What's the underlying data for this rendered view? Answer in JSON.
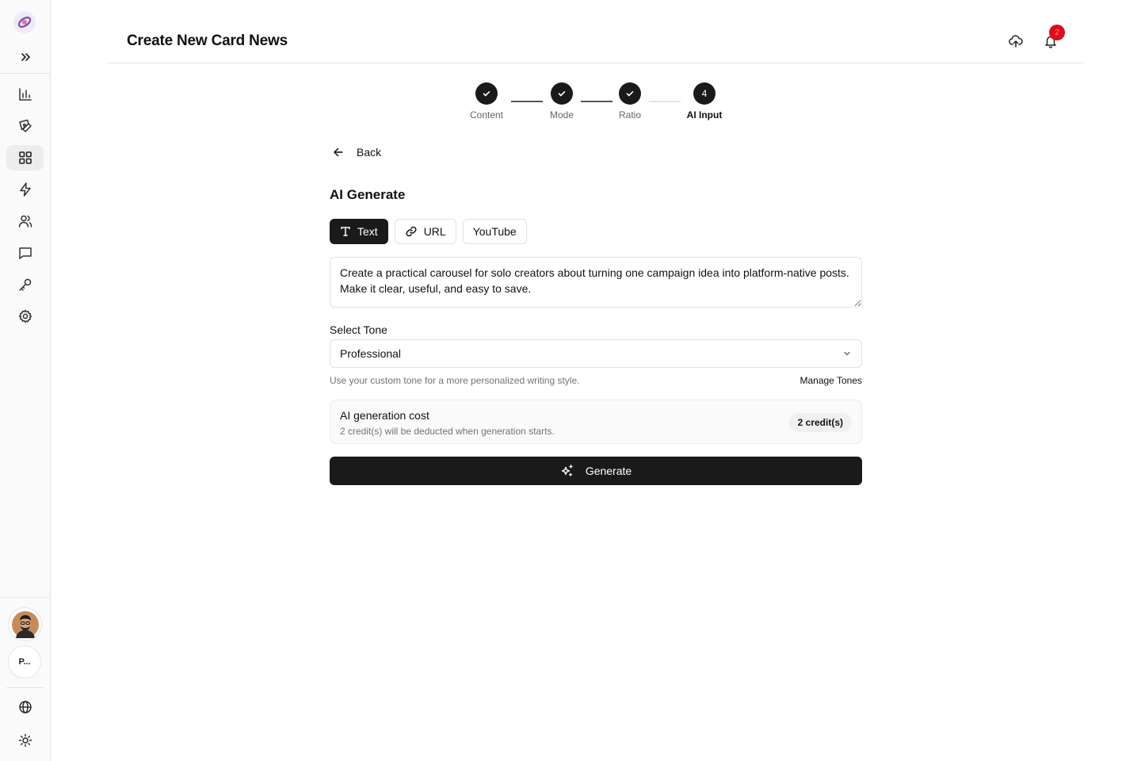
{
  "sidebar": {
    "nav_items": [
      {
        "icon": "bar-chart-icon",
        "active": false
      },
      {
        "icon": "pen-tool-icon",
        "active": false
      },
      {
        "icon": "grid-icon",
        "active": true
      },
      {
        "icon": "lightning-icon",
        "active": false
      },
      {
        "icon": "users-icon",
        "active": false
      },
      {
        "icon": "message-icon",
        "active": false
      },
      {
        "icon": "key-icon",
        "active": false
      },
      {
        "icon": "gear-icon",
        "active": false
      }
    ],
    "workspace_label": "P..."
  },
  "header": {
    "title": "Create New Card News",
    "notification_count": "2"
  },
  "stepper": {
    "steps": [
      {
        "label": "Content",
        "state": "done"
      },
      {
        "label": "Mode",
        "state": "done"
      },
      {
        "label": "Ratio",
        "state": "done"
      },
      {
        "label": "AI Input",
        "state": "current",
        "number": "4"
      }
    ]
  },
  "main": {
    "back_label": "Back",
    "section_title": "AI Generate",
    "tabs": [
      {
        "label": "Text",
        "icon": "text-icon",
        "active": true
      },
      {
        "label": "URL",
        "icon": "link-icon",
        "active": false
      },
      {
        "label": "YouTube",
        "icon": "",
        "active": false
      }
    ],
    "prompt_value": "Create a practical carousel for solo creators about turning one campaign idea into platform-native posts. Make it clear, useful, and easy to save.",
    "tone_label": "Select Tone",
    "tone_value": "Professional",
    "tone_hint": "Use your custom tone for a more personalized writing style.",
    "manage_tones_label": "Manage Tones",
    "cost": {
      "title": "AI generation cost",
      "description": "2 credit(s) will be deducted when generation starts.",
      "badge": "2 credit(s)"
    },
    "generate_label": "Generate"
  },
  "colors": {
    "primary": "#1a1a1a",
    "badge_red": "#e00b1b",
    "muted_text": "#737373"
  }
}
